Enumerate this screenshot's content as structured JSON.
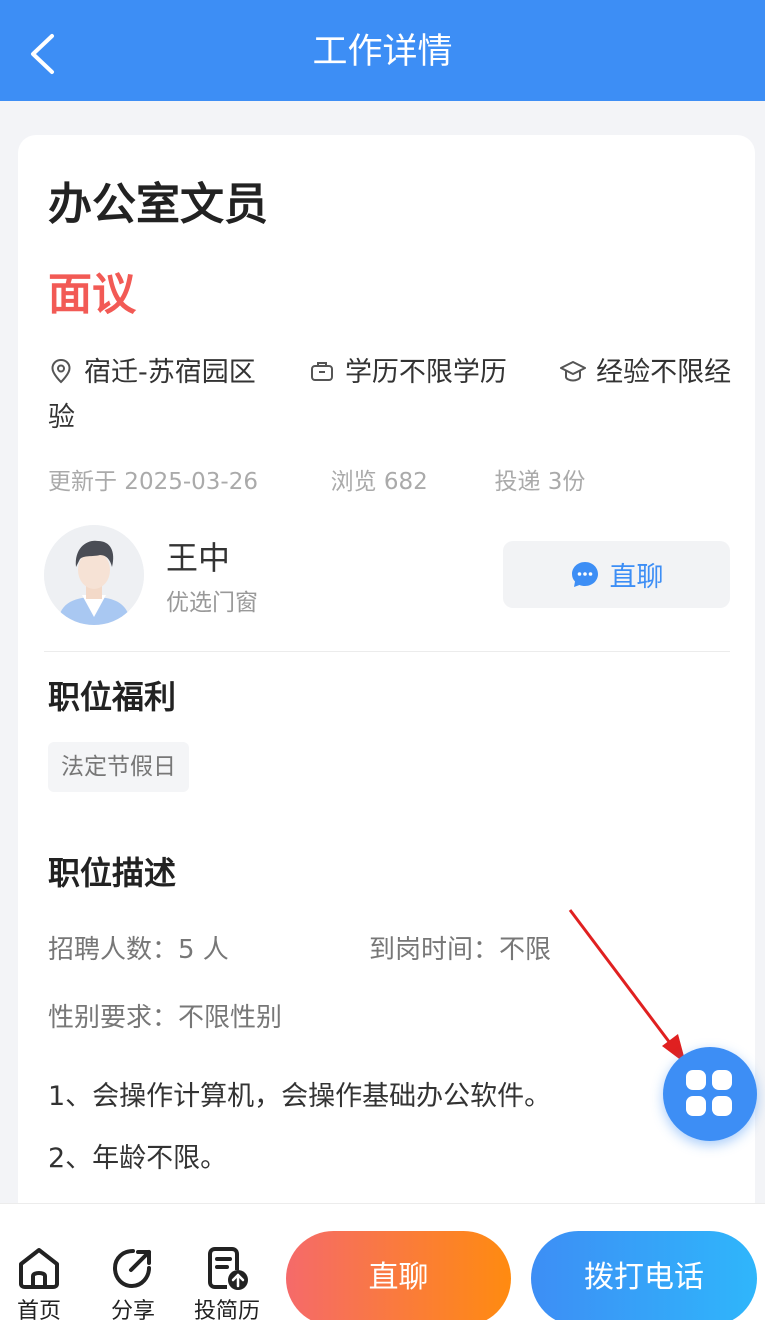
{
  "header": {
    "title": "工作详情",
    "back_icon": "chevron-left-icon"
  },
  "job": {
    "title": "办公室文员",
    "salary": "面议",
    "location": "宿迁-苏宿园区",
    "education": "学历不限学历",
    "experience": "经验不限经验",
    "updated": "更新于 2025-03-26",
    "views": "浏览 682",
    "applications": "投递 3份"
  },
  "recruiter": {
    "name": "王中",
    "company": "优选门窗",
    "chat_label": "直聊"
  },
  "benefits": {
    "title": "职位福利",
    "tags": [
      "法定节假日"
    ]
  },
  "description": {
    "title": "职位描述",
    "headcount": "招聘人数：5 人",
    "start_time": "到岗时间：不限",
    "gender": "性别要求：不限性别",
    "lines": [
      "1、会操作计算机，会操作基础办公软件。",
      "2、年龄不限。"
    ]
  },
  "bottom_bar": {
    "home": "首页",
    "share": "分享",
    "resume": "投简历",
    "chat": "直聊",
    "call": "拨打电话"
  },
  "colors": {
    "primary": "#3d8ef5",
    "salary": "#f25a55",
    "chat_gradient": [
      "#f56a6a",
      "#ff8b10"
    ],
    "call_gradient": [
      "#3d8ef5",
      "#2fb6fb"
    ],
    "annotation_arrow": "#e02020"
  }
}
